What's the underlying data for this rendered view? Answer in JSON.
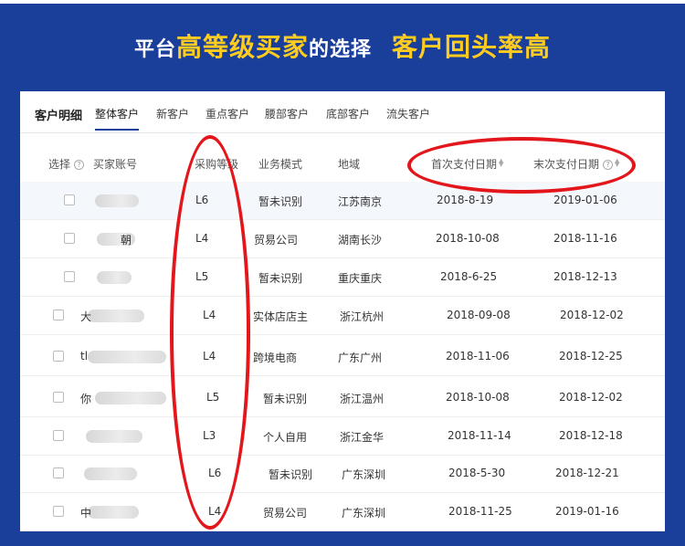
{
  "banner": {
    "part1": "平台",
    "part2": "高等级买家",
    "part3": "的选择",
    "part4": "客户回头率高"
  },
  "panel": {
    "title": "客户明细",
    "tabs": [
      "整体客户",
      "新客户",
      "重点客户",
      "腰部客户",
      "底部客户",
      "流失客户"
    ],
    "active_tab": "整体客户",
    "columns": {
      "select": "选择",
      "account": "买家账号",
      "level": "采购等级",
      "mode": "业务模式",
      "region": "地域",
      "first_pay": "首次支付日期",
      "last_pay": "末次支付日期"
    }
  },
  "rows": [
    {
      "account": "",
      "level": "L6",
      "mode": "暂未识别",
      "region": "江苏南京",
      "first": "2018-8-19",
      "last": "2019-01-06"
    },
    {
      "account": "朝",
      "level": "L4",
      "mode": "贸易公司",
      "region": "湖南长沙",
      "first": "2018-10-08",
      "last": "2018-11-16"
    },
    {
      "account": "",
      "level": "L5",
      "mode": "暂未识别",
      "region": "重庆重庆",
      "first": "2018-6-25",
      "last": "2018-12-13"
    },
    {
      "account": "大",
      "level": "L4",
      "mode": "实体店店主",
      "region": "浙江杭州",
      "first": "2018-09-08",
      "last": "2018-12-02"
    },
    {
      "account": "tl",
      "level": "L4",
      "mode": "跨境电商",
      "region": "广东广州",
      "first": "2018-11-06",
      "last": "2018-12-25"
    },
    {
      "account": "你",
      "level": "L5",
      "mode": "暂未识别",
      "region": "浙江温州",
      "first": "2018-10-08",
      "last": "2018-12-02"
    },
    {
      "account": "",
      "level": "L3",
      "mode": "个人自用",
      "region": "浙江金华",
      "first": "2018-11-14",
      "last": "2018-12-18"
    },
    {
      "account": "",
      "level": "L6",
      "mode": "暂未识别",
      "region": "广东深圳",
      "first": "2018-5-30",
      "last": "2018-12-21"
    },
    {
      "account": "中",
      "level": "L4",
      "mode": "贸易公司",
      "region": "广东深圳",
      "first": "2018-11-25",
      "last": "2019-01-16"
    }
  ]
}
